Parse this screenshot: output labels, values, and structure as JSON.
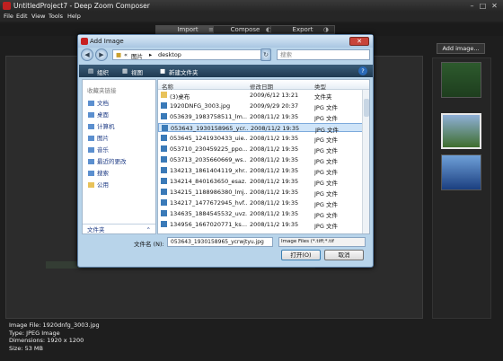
{
  "app": {
    "title": "UntitledProject7 - Deep Zoom Composer",
    "minimize": "–",
    "maximize": "□",
    "close": "✕"
  },
  "menu": [
    "File",
    "Edit",
    "View",
    "Tools",
    "Help"
  ],
  "modes": [
    {
      "label": "Import",
      "active": true
    },
    {
      "label": "Compose",
      "active": false
    },
    {
      "label": "Export",
      "active": false
    }
  ],
  "right_panel": {
    "add_image_label": "Add image..."
  },
  "thumbnails": [
    {
      "name": "green-texture-thumb",
      "colors": [
        "#2d5a2d",
        "#1e3e1e"
      ],
      "selected": false
    },
    {
      "name": "landscape-thumb",
      "colors": [
        "#8fb0d8",
        "#3f6e2e"
      ],
      "selected": true
    },
    {
      "name": "blue-sky-thumb",
      "colors": [
        "#6fa0d8",
        "#1b3f80"
      ],
      "selected": false
    }
  ],
  "status": {
    "image_file": "Image File: 1920dnfg_3003.jpg",
    "type": "Type: JPEG Image",
    "dimensions": "Dimensions: 1920 x 1200",
    "size": "Size: 53 MB"
  },
  "dialog": {
    "title": "Add Image",
    "close": "✕",
    "back": "◀",
    "forward": "▶",
    "path_prefix": "«",
    "path_1": "图片",
    "path_sep": "▸",
    "path_2": "desktop",
    "refresh": "↻",
    "search_placeholder": "搜索",
    "organize": "组织",
    "views": "视图",
    "new_folder": "新建文件夹",
    "help": "?",
    "favorites_header": "收藏夹链接",
    "favorites": [
      "文档",
      "桌面",
      "计算机",
      "图片",
      "音乐",
      "最近的更改",
      "搜索",
      "公用"
    ],
    "folders_label": "文件夹",
    "columns": {
      "name": "名称",
      "date": "修改日期",
      "type": "类型"
    },
    "files": [
      {
        "name": "(3)桌布",
        "date": "2009/6/12 13:21",
        "type": "文件夹",
        "kind": "folder",
        "selected": false
      },
      {
        "name": "1920DNFG_3003.jpg",
        "date": "2009/9/29 20:37",
        "type": "JPG 文件",
        "kind": "file",
        "selected": false
      },
      {
        "name": "053639_1983758511_lm...",
        "date": "2008/11/2 19:35",
        "type": "JPG 文件",
        "kind": "file",
        "selected": false
      },
      {
        "name": "053643_1930158965_ycr...",
        "date": "2008/11/2 19:35",
        "type": "JPG 文件",
        "kind": "file",
        "selected": true
      },
      {
        "name": "053645_1241930433_uie...",
        "date": "2008/11/2 19:35",
        "type": "JPG 文件",
        "kind": "file",
        "selected": false
      },
      {
        "name": "053710_230459225_ppo...",
        "date": "2008/11/2 19:35",
        "type": "JPG 文件",
        "kind": "file",
        "selected": false
      },
      {
        "name": "053713_2035660669_ws...",
        "date": "2008/11/2 19:35",
        "type": "JPG 文件",
        "kind": "file",
        "selected": false
      },
      {
        "name": "134213_1861404119_xhr...",
        "date": "2008/11/2 19:35",
        "type": "JPG 文件",
        "kind": "file",
        "selected": false
      },
      {
        "name": "134214_840163650_esaz...",
        "date": "2008/11/2 19:35",
        "type": "JPG 文件",
        "kind": "file",
        "selected": false
      },
      {
        "name": "134215_1188986380_lmj...",
        "date": "2008/11/2 19:35",
        "type": "JPG 文件",
        "kind": "file",
        "selected": false
      },
      {
        "name": "134217_1477672945_hvf...",
        "date": "2008/11/2 19:35",
        "type": "JPG 文件",
        "kind": "file",
        "selected": false
      },
      {
        "name": "134635_1884545532_uvz...",
        "date": "2008/11/2 19:35",
        "type": "JPG 文件",
        "kind": "file",
        "selected": false
      },
      {
        "name": "134956_1667020771_ks...",
        "date": "2008/11/2 19:35",
        "type": "JPG 文件",
        "kind": "file",
        "selected": false
      }
    ],
    "filename_label": "文件名 (N):",
    "filename_value": "053643_1930158965_ycrwjtyu.jpg",
    "filetype_value": "Image Files (*.tiff;*.tif",
    "open_label": "打开(O)",
    "cancel_label": "取消"
  }
}
